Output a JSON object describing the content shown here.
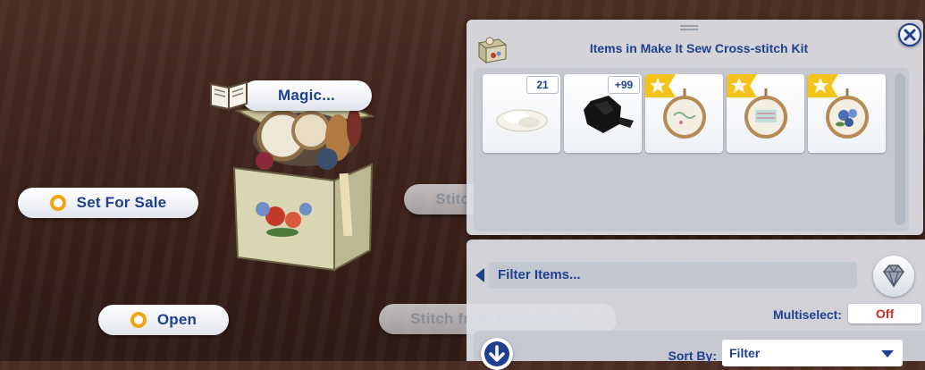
{
  "pie_menu": {
    "magic": "Magic...",
    "set_for_sale": "Set For Sale",
    "stitch_patterns": "Stitch from Patterns...",
    "open": "Open",
    "stitch_reference": "Stitch from Reference..."
  },
  "panel": {
    "title": "Items in Make It Sew Cross-stitch Kit",
    "items": [
      {
        "name": "white-fabric-icon",
        "badge": "21"
      },
      {
        "name": "black-yarn-ball-icon",
        "badge": "+99"
      },
      {
        "name": "cross-stitch-hoop-1-icon",
        "badge": ""
      },
      {
        "name": "cross-stitch-hoop-2-icon",
        "badge": ""
      },
      {
        "name": "cross-stitch-hoop-floral-icon",
        "badge": ""
      }
    ],
    "filter_placeholder": "Filter Items...",
    "multiselect_label": "Multiselect:",
    "multiselect_value": "Off",
    "sort_label": "Sort By:",
    "sort_value": "Filter"
  },
  "colors": {
    "accent": "#1f3f8f",
    "ring": "#f3a415",
    "off": "#d42a2a",
    "star": "#f5c21b"
  }
}
